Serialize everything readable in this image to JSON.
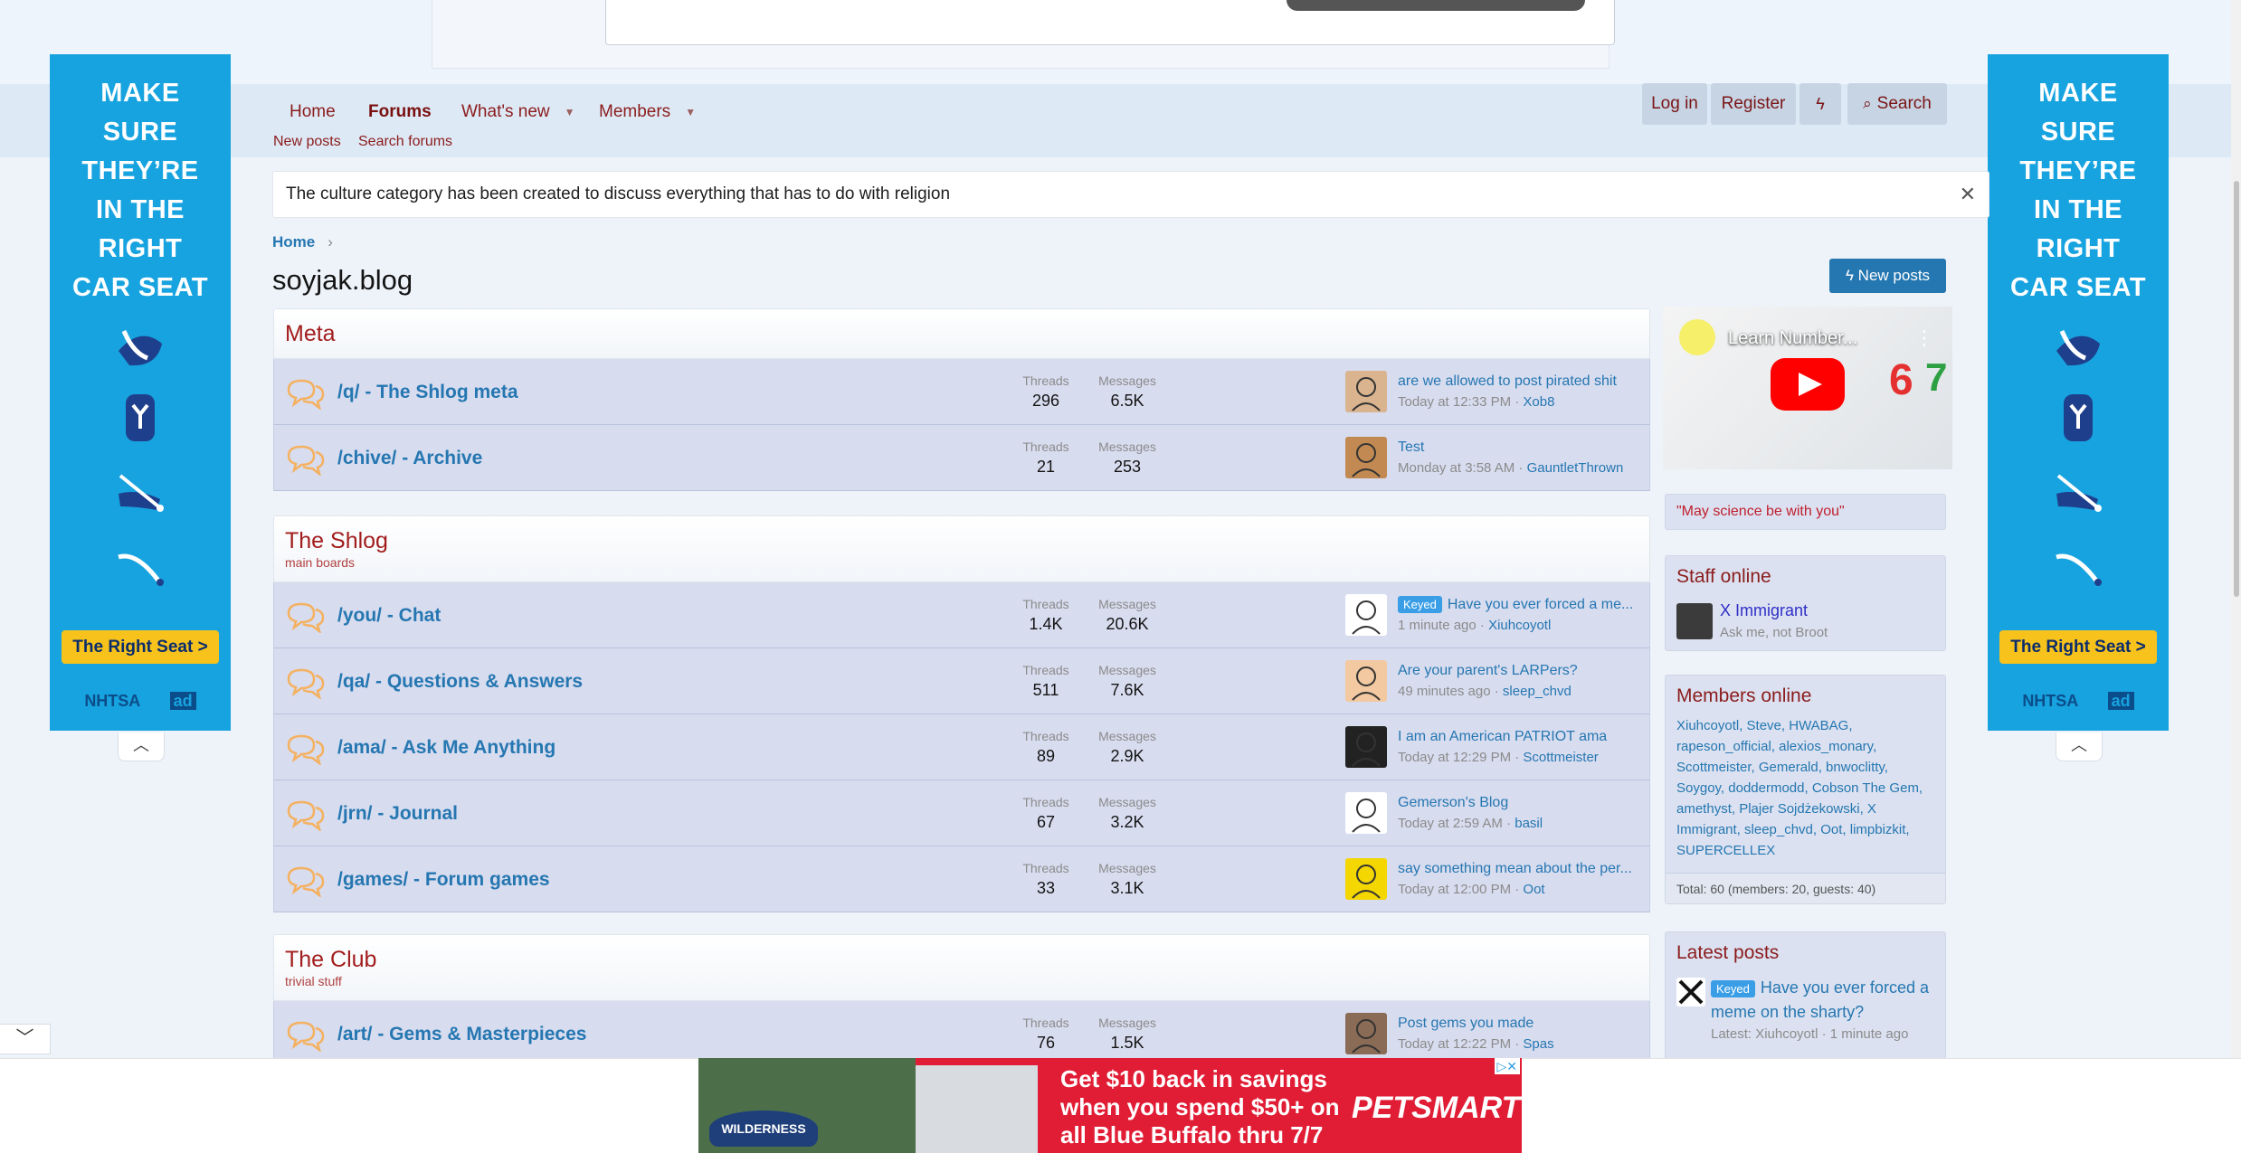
{
  "side_ad": {
    "headline_lines": [
      "MAKE",
      "SURE",
      "THEY’RE",
      "IN THE",
      "RIGHT",
      "CAR SEAT"
    ],
    "cta": "The Right Seat >",
    "sponsor": "NHTSA",
    "ad_mark": "ad"
  },
  "nav": {
    "home": "Home",
    "forums": "Forums",
    "whats_new": "What's new",
    "members": "Members",
    "new_posts": "New posts",
    "search_forums": "Search forums",
    "login": "Log in",
    "register": "Register",
    "search": "Search"
  },
  "notice": "The culture category has been created to discuss everything that has to do with religion",
  "breadcrumb": "Home",
  "page_title": "soyjak.blog",
  "new_posts_button": "New posts",
  "labels": {
    "threads": "Threads",
    "messages": "Messages"
  },
  "categories": [
    {
      "title": "Meta",
      "description": "",
      "nodes": [
        {
          "title": "/q/ - The Shlog meta",
          "threads": "296",
          "messages": "6.5K",
          "badge": "",
          "last_title": "are we allowed to post pirated shit",
          "last_time": "Today at 12:33 PM",
          "last_user": "Xob8"
        },
        {
          "title": "/chive/ - Archive",
          "threads": "21",
          "messages": "253",
          "badge": "",
          "last_title": "Test",
          "last_time": "Monday at 3:58 AM",
          "last_user": "GauntletThrown"
        }
      ]
    },
    {
      "title": "The Shlog",
      "description": "main boards",
      "nodes": [
        {
          "title": "/you/ - Chat",
          "threads": "1.4K",
          "messages": "20.6K",
          "badge": "Keyed",
          "last_title": "Have you ever forced a me...",
          "last_time": "1 minute ago",
          "last_user": "Xiuhcoyotl"
        },
        {
          "title": "/qa/ - Questions & Answers",
          "threads": "511",
          "messages": "7.6K",
          "badge": "",
          "last_title": "Are your parent's LARPers?",
          "last_time": "49 minutes ago",
          "last_user": "sleep_chvd"
        },
        {
          "title": "/ama/ - Ask Me Anything",
          "threads": "89",
          "messages": "2.9K",
          "badge": "",
          "last_title": "I am an American PATRIOT ama",
          "last_time": "Today at 12:29 PM",
          "last_user": "Scottmeister"
        },
        {
          "title": "/jrn/ - Journal",
          "threads": "67",
          "messages": "3.2K",
          "badge": "",
          "last_title": "Gemerson's Blog",
          "last_time": "Today at 2:59 AM",
          "last_user": "basil"
        },
        {
          "title": "/games/ - Forum games",
          "threads": "33",
          "messages": "3.1K",
          "badge": "",
          "last_title": "say something mean about the per...",
          "last_time": "Today at 12:00 PM",
          "last_user": "Oot"
        }
      ]
    },
    {
      "title": "The Club",
      "description": "trivial stuff",
      "nodes": [
        {
          "title": "/art/ - Gems & Masterpieces",
          "threads": "76",
          "messages": "1.5K",
          "badge": "",
          "last_title": "Post gems you made",
          "last_time": "Today at 12:22 PM",
          "last_user": "Spas"
        }
      ]
    }
  ],
  "sidebar": {
    "video_title": "Learn Number...",
    "quote": "\"May science be with you\"",
    "staff_title": "Staff online",
    "staff_name": "X Immigrant",
    "staff_status": "Ask me, not Broot",
    "members_title": "Members online",
    "members_list": "Xiuhcoyotl, Steve, HWABAG, rapeson_official, alexios_monary, Scottmeister, Gemerald, bnwoclitty, Soygoy, doddermodd, Cobson The Gem, amethyst, Plajer Sojdżekowski, X Immigrant, sleep_chvd, Oot, limpbizkit, SUPERCELLEX",
    "total": "Total: 60 (members: 20, guests: 40)",
    "latest_title": "Latest posts",
    "latest_badge": "Keyed",
    "latest_post": "Have you ever forced a meme on the sharty?",
    "latest_meta": "Latest: Xiuhcoyotl · 1 minute ago"
  },
  "bottom_ad": {
    "brand": "WILDERNESS",
    "line1": "Get $10 back in savings",
    "line2": "when you spend $50+ on",
    "line3": "all Blue Buffalo thru 7/7",
    "store": "PETSMART"
  },
  "colors": {
    "accent": "#2577b1",
    "brand_red": "#8b1c1c",
    "node_bg": "#d8dcef"
  }
}
